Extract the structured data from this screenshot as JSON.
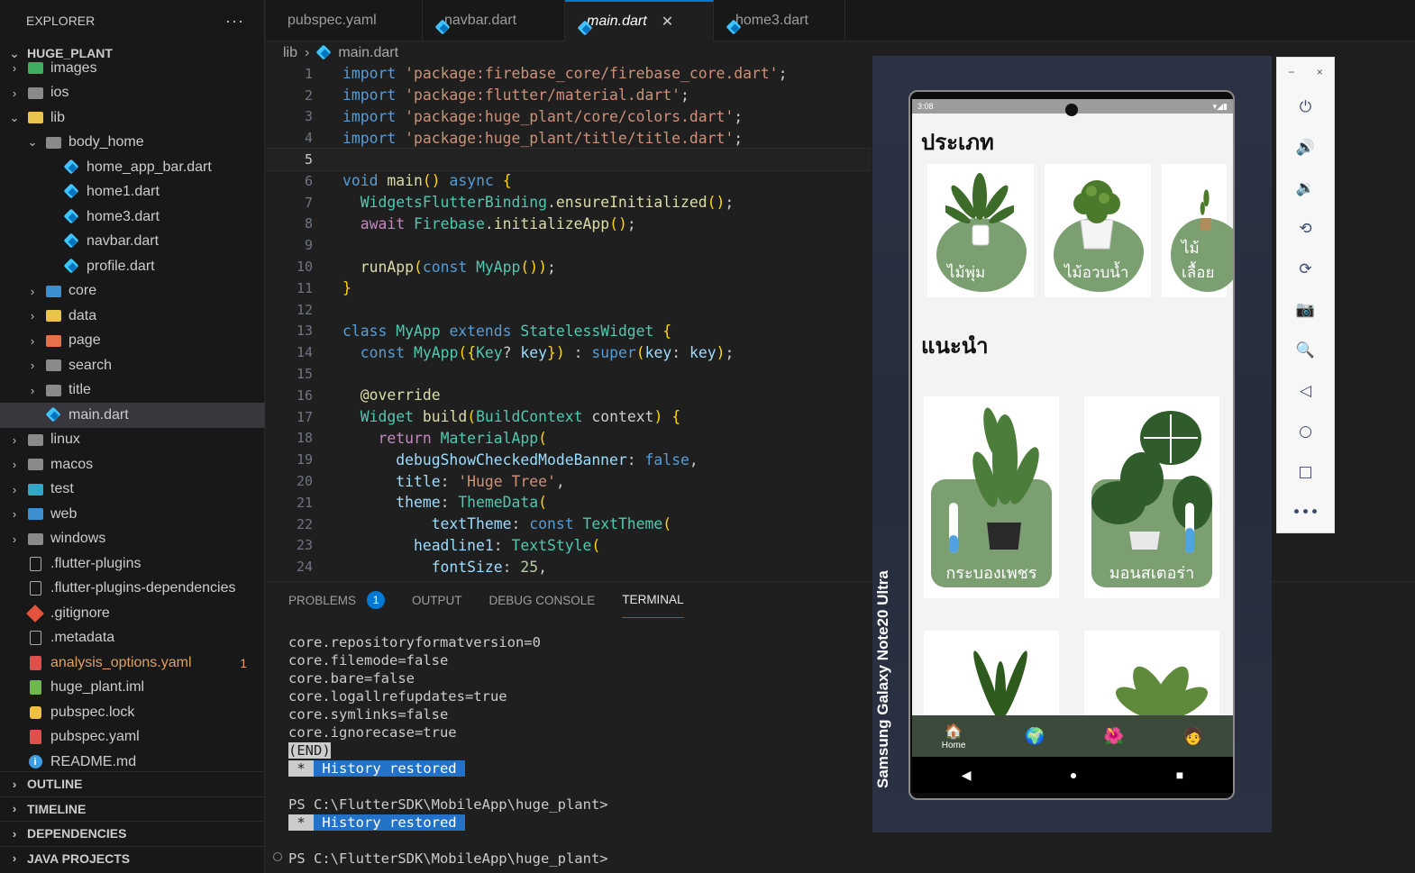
{
  "sidebar": {
    "header": "EXPLORER",
    "more": "···",
    "root": "HUGE_PLANT",
    "items": [
      {
        "label": "images",
        "depth": 1,
        "chev": "›",
        "icon": "folder-green"
      },
      {
        "label": "ios",
        "depth": 1,
        "chev": "›",
        "icon": "folder-gray"
      },
      {
        "label": "lib",
        "depth": 1,
        "chev": "⌄",
        "icon": "folder-yellow"
      },
      {
        "label": "body_home",
        "depth": 2,
        "chev": "⌄",
        "icon": "folder-gray"
      },
      {
        "label": "home_app_bar.dart",
        "depth": 3,
        "icon": "dart"
      },
      {
        "label": "home1.dart",
        "depth": 3,
        "icon": "dart"
      },
      {
        "label": "home3.dart",
        "depth": 3,
        "icon": "dart"
      },
      {
        "label": "navbar.dart",
        "depth": 3,
        "icon": "dart"
      },
      {
        "label": "profile.dart",
        "depth": 3,
        "icon": "dart"
      },
      {
        "label": "core",
        "depth": 2,
        "chev": "›",
        "icon": "folder-blue"
      },
      {
        "label": "data",
        "depth": 2,
        "chev": "›",
        "icon": "folder-yellow"
      },
      {
        "label": "page",
        "depth": 2,
        "chev": "›",
        "icon": "folder-orange"
      },
      {
        "label": "search",
        "depth": 2,
        "chev": "›",
        "icon": "folder-gray"
      },
      {
        "label": "title",
        "depth": 2,
        "chev": "›",
        "icon": "folder-gray"
      },
      {
        "label": "main.dart",
        "depth": 2,
        "icon": "dart",
        "selected": true
      },
      {
        "label": "linux",
        "depth": 1,
        "chev": "›",
        "icon": "folder-gray"
      },
      {
        "label": "macos",
        "depth": 1,
        "chev": "›",
        "icon": "folder-gray"
      },
      {
        "label": "test",
        "depth": 1,
        "chev": "›",
        "icon": "folder-cyan"
      },
      {
        "label": "web",
        "depth": 1,
        "chev": "›",
        "icon": "folder-blue"
      },
      {
        "label": "windows",
        "depth": 1,
        "chev": "›",
        "icon": "folder-gray"
      },
      {
        "label": ".flutter-plugins",
        "depth": 1,
        "icon": "file"
      },
      {
        "label": ".flutter-plugins-dependencies",
        "depth": 1,
        "icon": "file"
      },
      {
        "label": ".gitignore",
        "depth": 1,
        "icon": "git"
      },
      {
        "label": ".metadata",
        "depth": 1,
        "icon": "file"
      },
      {
        "label": "analysis_options.yaml",
        "depth": 1,
        "icon": "yaml",
        "warn": true,
        "badge": "1"
      },
      {
        "label": "huge_plant.iml",
        "depth": 1,
        "icon": "iml"
      },
      {
        "label": "pubspec.lock",
        "depth": 1,
        "icon": "lock"
      },
      {
        "label": "pubspec.yaml",
        "depth": 1,
        "icon": "yaml"
      },
      {
        "label": "README.md",
        "depth": 1,
        "icon": "info"
      }
    ],
    "sections": [
      "OUTLINE",
      "TIMELINE",
      "DEPENDENCIES",
      "JAVA PROJECTS"
    ]
  },
  "tabs": [
    {
      "label": "pubspec.yaml",
      "icon": "yaml"
    },
    {
      "label": "navbar.dart",
      "icon": "dart"
    },
    {
      "label": "main.dart",
      "icon": "dart",
      "active": true,
      "close": "✕"
    },
    {
      "label": "home3.dart",
      "icon": "dart"
    }
  ],
  "breadcrumb": {
    "folder": "lib",
    "sep": "›",
    "file": "main.dart"
  },
  "editor": {
    "current_line": 5,
    "lines": [
      "import 'package:firebase_core/firebase_core.dart';",
      "import 'package:flutter/material.dart';",
      "import 'package:huge_plant/core/colors.dart';",
      "import 'package:huge_plant/title/title.dart';",
      "",
      "void main() async {",
      "  WidgetsFlutterBinding.ensureInitialized();",
      "  await Firebase.initializeApp();",
      "",
      "  runApp(const MyApp());",
      "}",
      "",
      "class MyApp extends StatelessWidget {",
      "  const MyApp({Key? key}) : super(key: key);",
      "",
      "  @override",
      "  Widget build(BuildContext context) {",
      "    return MaterialApp(",
      "      debugShowCheckedModeBanner: false,",
      "      title: 'Huge Tree',",
      "      theme: ThemeData(",
      "          textTheme: const TextTheme(",
      "        headline1: TextStyle(",
      "          fontSize: 25,"
    ]
  },
  "panel": {
    "tabs": [
      {
        "label": "PROBLEMS",
        "badge": "1"
      },
      {
        "label": "OUTPUT"
      },
      {
        "label": "DEBUG CONSOLE"
      },
      {
        "label": "TERMINAL",
        "active": true
      }
    ],
    "terminal": {
      "lines": [
        "core.repositoryformatversion=0",
        "core.filemode=false",
        "core.bare=false",
        "core.logallrefupdates=true",
        "core.symlinks=false",
        "core.ignorecase=true"
      ],
      "end_marker": "(END)",
      "history_star": " * ",
      "history_text": " History restored ",
      "prompt": "PS C:\\FlutterSDK\\MobileApp\\huge_plant>"
    }
  },
  "emulator": {
    "device_name": "Samsung Galaxy  Note20 Ultra",
    "status_time": "3:08",
    "category_title": "ประเภท",
    "categories": [
      "ไม้พุ่ม",
      "ไม้อวบน้ำ",
      "ไม้เลื้อย"
    ],
    "recommend_title": "แนะนำ",
    "recommended": [
      {
        "name": "กระบองเพชร",
        "level": 0.35
      },
      {
        "name": "มอนสเตอร่า",
        "level": 0.5
      }
    ],
    "nav": {
      "home_label": "Home"
    },
    "colors": {
      "card_green": "#7b9f71",
      "navbar": "#3b4a3b"
    }
  },
  "emulator_toolbar": {
    "minimize": "−",
    "close": "×",
    "buttons": [
      "power-icon",
      "volume-up-icon",
      "volume-down-icon",
      "rotate-left-icon",
      "rotate-right-icon",
      "camera-icon",
      "zoom-icon",
      "back-icon",
      "home-icon",
      "overview-icon",
      "more-icon"
    ]
  }
}
